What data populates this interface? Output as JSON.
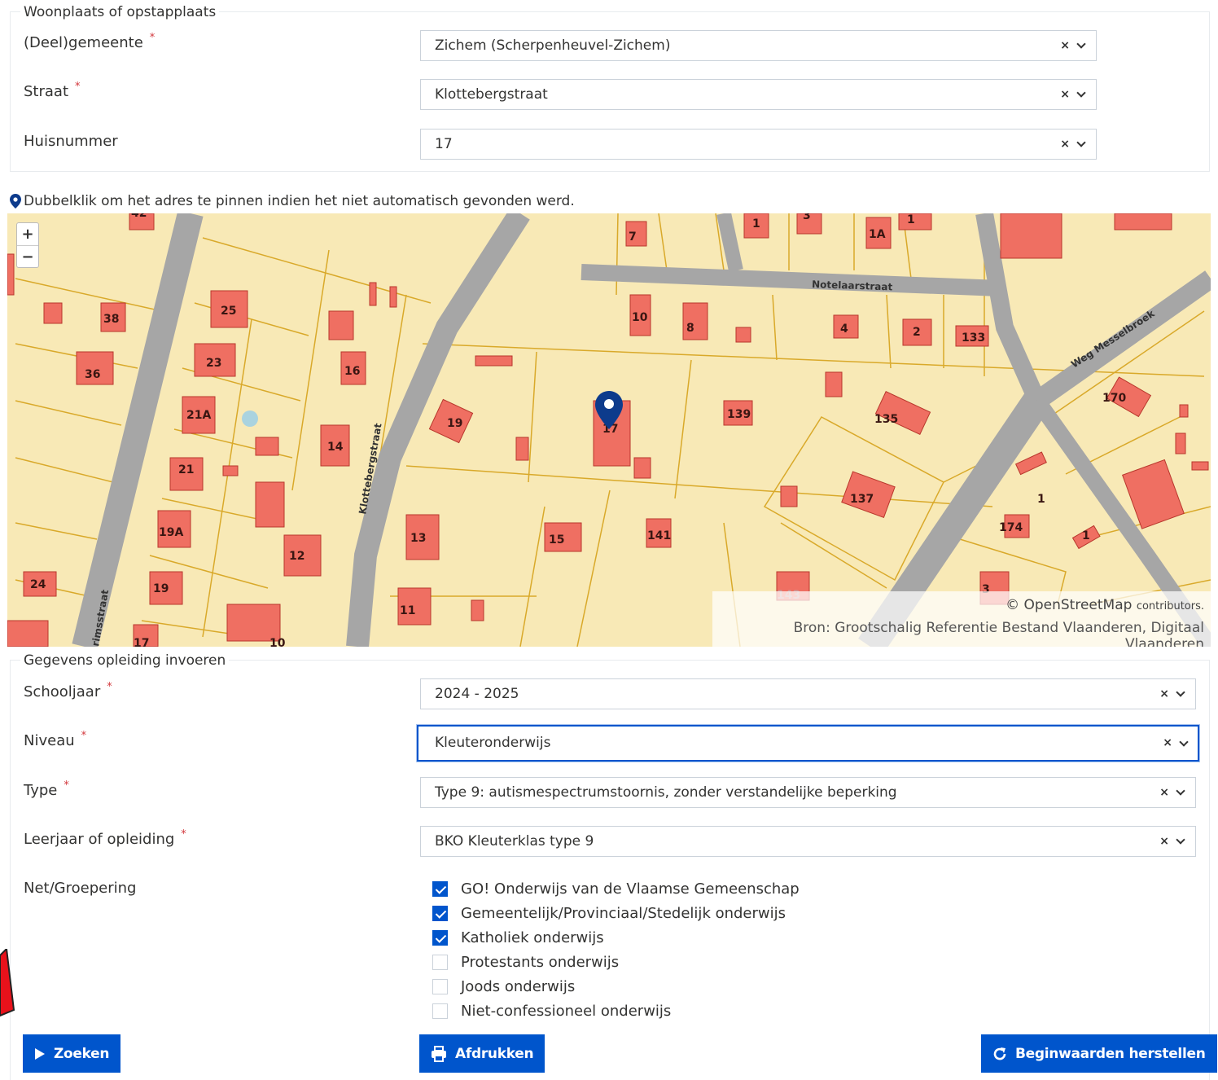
{
  "address": {
    "legend": "Woonplaats of opstapplaats",
    "gemeente": {
      "label": "(Deel)gemeente",
      "value": "Zichem (Scherpenheuvel-Zichem)"
    },
    "straat": {
      "label": "Straat",
      "value": "Klottebergstraat"
    },
    "huisnummer": {
      "label": "Huisnummer",
      "value": "17"
    }
  },
  "required_mark": "*",
  "clear_mark": "×",
  "map": {
    "hint": "Dubbelklik om het adres te pinnen indien het niet automatisch gevonden werd.",
    "zoom_in": "+",
    "zoom_out": "−",
    "osm_prefix": "© OpenStreetMap",
    "osm_suffix": "contributors.",
    "source": "Bron: Grootschalig Referentie Bestand Vlaanderen, Digitaal Vlaanderen",
    "street_labels": [
      "Notelaarstraat",
      "Klottebergstraat",
      "Weg Messelbroek",
      "rimsstraat"
    ],
    "house_numbers": [
      "7",
      "1",
      "3",
      "1A",
      "1",
      "38",
      "25",
      "36",
      "23",
      "16",
      "10",
      "8",
      "4",
      "2",
      "133",
      "21A",
      "14",
      "19",
      "17",
      "139",
      "135",
      "170",
      "21",
      "137",
      "19A",
      "12",
      "13",
      "15",
      "141",
      "174",
      "1",
      "1",
      "24",
      "19",
      "11",
      "3",
      "143",
      "17",
      "10",
      "42"
    ],
    "colors": {
      "land": "#f8e9b6",
      "building": "#ef6f62",
      "road": "#a6a6a6",
      "parcel": "#d9a92a",
      "pin": "#0d3b8c"
    }
  },
  "education": {
    "legend": "Gegevens opleiding invoeren",
    "schooljaar": {
      "label": "Schooljaar",
      "value": "2024 - 2025"
    },
    "niveau": {
      "label": "Niveau",
      "value": "Kleuteronderwijs"
    },
    "type": {
      "label": "Type",
      "value": "Type 9: autismespectrumstoornis, zonder verstandelijke beperking"
    },
    "leerjaar": {
      "label": "Leerjaar of opleiding",
      "value": "BKO Kleuterklas type 9"
    },
    "net": {
      "label": "Net/Groepering",
      "options": [
        {
          "label": "GO! Onderwijs van de Vlaamse Gemeenschap",
          "checked": true
        },
        {
          "label": "Gemeentelijk/Provinciaal/Stedelijk onderwijs",
          "checked": true
        },
        {
          "label": "Katholiek onderwijs",
          "checked": true
        },
        {
          "label": "Protestants onderwijs",
          "checked": false
        },
        {
          "label": "Joods onderwijs",
          "checked": false
        },
        {
          "label": "Niet-confessioneel onderwijs",
          "checked": false
        }
      ]
    }
  },
  "buttons": {
    "search": "Zoeken",
    "print": "Afdrukken",
    "reset": "Beginwaarden herstellen"
  },
  "theme": {
    "primary": "#0055cc",
    "required": "#d2373c"
  }
}
